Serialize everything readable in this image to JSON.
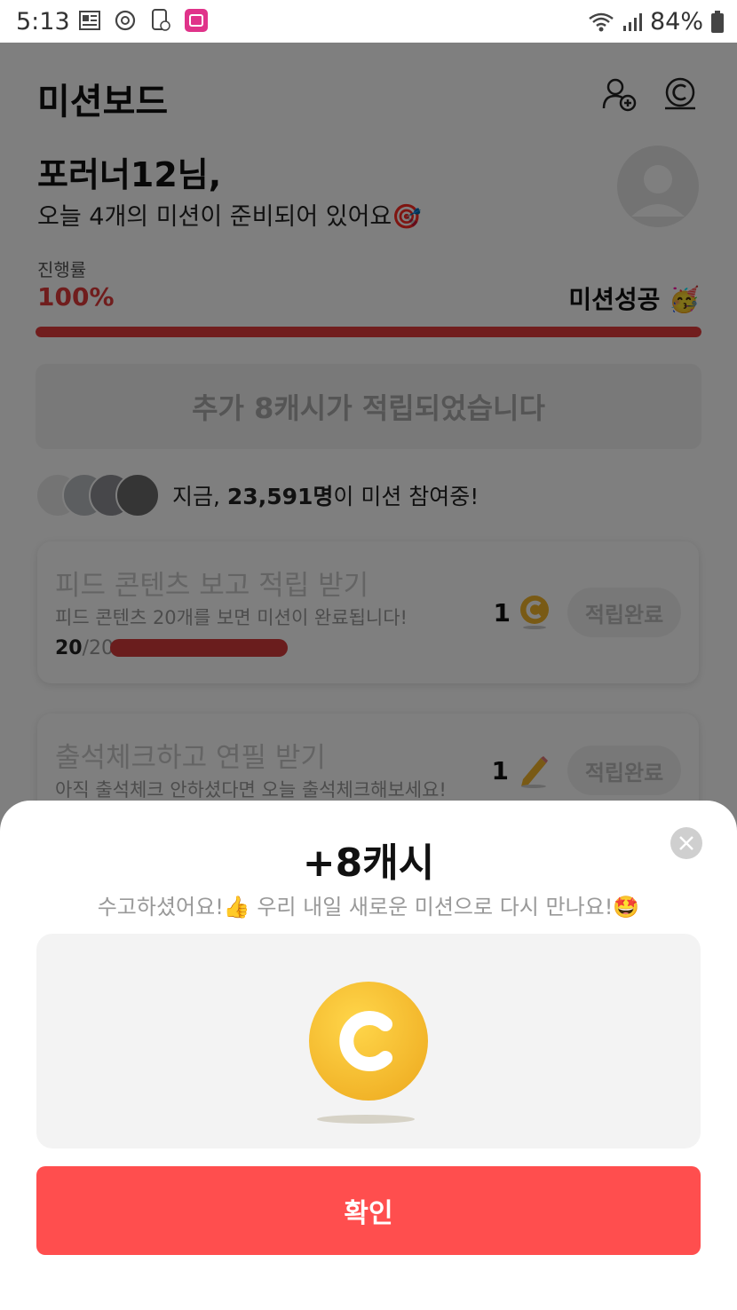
{
  "status_bar": {
    "time": "5:13",
    "battery": "84%"
  },
  "header": {
    "title": "미션보드"
  },
  "greeting": {
    "name": "포러너12님,",
    "message": "오늘 4개의 미션이 준비되어 있어요🎯"
  },
  "progress": {
    "label": "진행률",
    "value_text": "100%",
    "fraction": 1.0,
    "success_text": "미션성공 🥳"
  },
  "banner": {
    "text": "추가 8캐시가 적립되었습니다"
  },
  "participants": {
    "prefix": "지금, ",
    "count": "23,591명",
    "suffix": "이 미션 참여중!"
  },
  "missions": [
    {
      "title": "피드 콘텐츠 보고 적립 받기",
      "desc": "피드 콘텐츠 20개를 보면 미션이 완료됩니다!",
      "progress_done": "20",
      "progress_total": "/20",
      "reward": "1",
      "reward_icon": "coin-icon",
      "button": "적립완료"
    },
    {
      "title": "출석체크하고 연필 받기",
      "desc": "아직 출석체크 안하셨다면 오늘 출석체크해보세요!",
      "reward": "1",
      "reward_icon": "pencil-icon",
      "button": "적립완료"
    }
  ],
  "modal": {
    "title": "+8캐시",
    "subtitle": "수고하셨어요!👍 우리 내일 새로운 미션으로 다시 만나요!🤩",
    "confirm_label": "확인"
  },
  "colors": {
    "accent": "#ff4e4e",
    "progress": "#e33b3b",
    "coin": "#f2b52a"
  }
}
